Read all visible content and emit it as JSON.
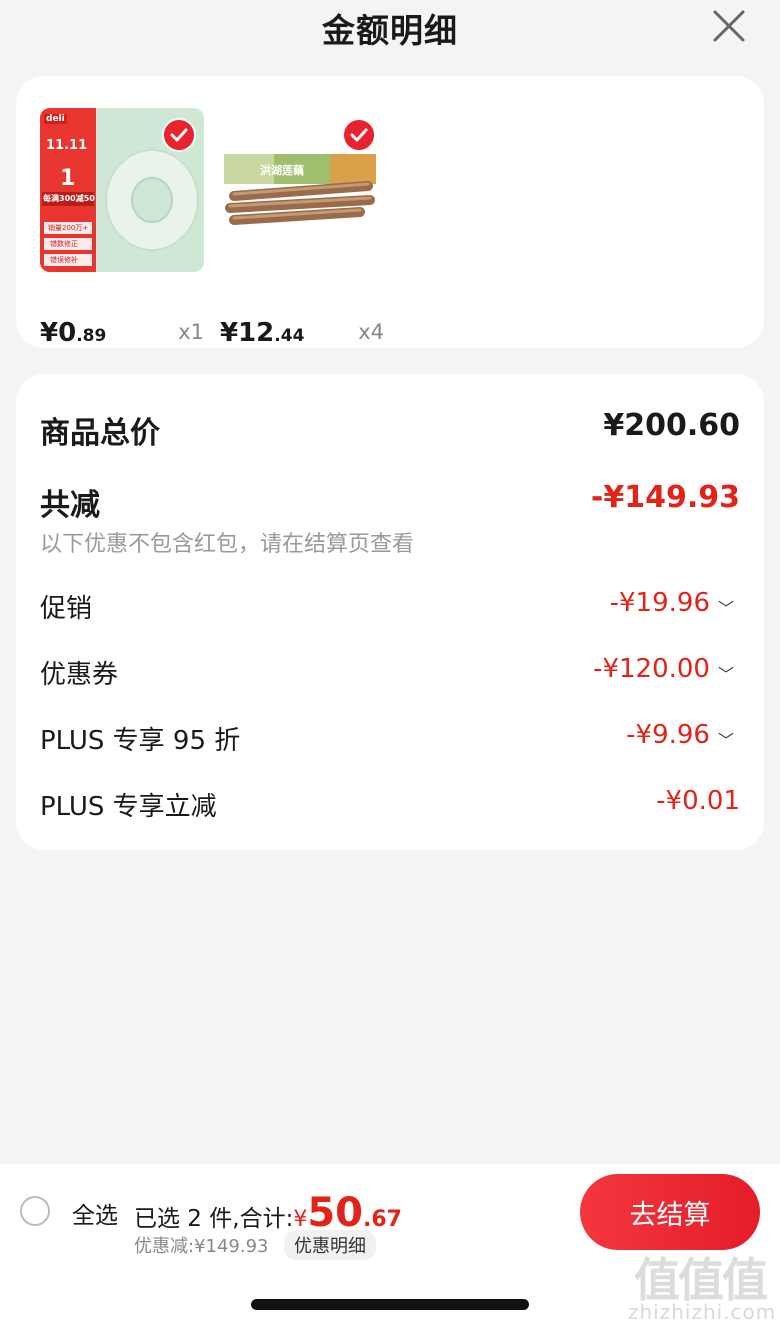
{
  "header": {
    "title": "金额明细",
    "close_icon": "close-icon"
  },
  "products": [
    {
      "price_int": "¥0",
      "price_dec": ".89",
      "qty": "x1",
      "checked": true,
      "image_text": {
        "brand": "deli",
        "badge": "11.11",
        "big_number": "1",
        "promo": "每满300减50",
        "tag1": "销量200万+",
        "tag2": "错数修正",
        "tag3": "错误修补"
      }
    },
    {
      "price_int": "¥12",
      "price_dec": ".44",
      "qty": "x4",
      "checked": true,
      "image_text": {
        "box_text": "洪湖莲藕"
      }
    }
  ],
  "summary": {
    "total_label": "商品总价",
    "total_value": "¥200.60",
    "reduce_label": "共减",
    "reduce_value": "-¥149.93",
    "note": "以下优惠不包含红包，请在结算页查看",
    "items": [
      {
        "label": "促销",
        "value": "-¥19.96",
        "expandable": true
      },
      {
        "label": "优惠券",
        "value": "-¥120.00",
        "expandable": true
      },
      {
        "label": "PLUS 专享 95 折",
        "value": "-¥9.96",
        "expandable": true
      },
      {
        "label": "PLUS 专享立减",
        "value": "-¥0.01",
        "expandable": false
      }
    ]
  },
  "bottom_bar": {
    "select_all": "全选",
    "selected_text": "已选 2 件,合计:",
    "total_currency": "¥",
    "total_int": "50",
    "total_dec": ".67",
    "discount_text": "优惠减:¥149.93",
    "detail_link": "优惠明细",
    "checkout_button": "去结算"
  },
  "watermark": {
    "text": "zhizhizhi.com",
    "glyphs": "值值值"
  },
  "colors": {
    "accent": "#e2231a",
    "checkout": "#e8222e",
    "background": "#f4f4f4"
  }
}
